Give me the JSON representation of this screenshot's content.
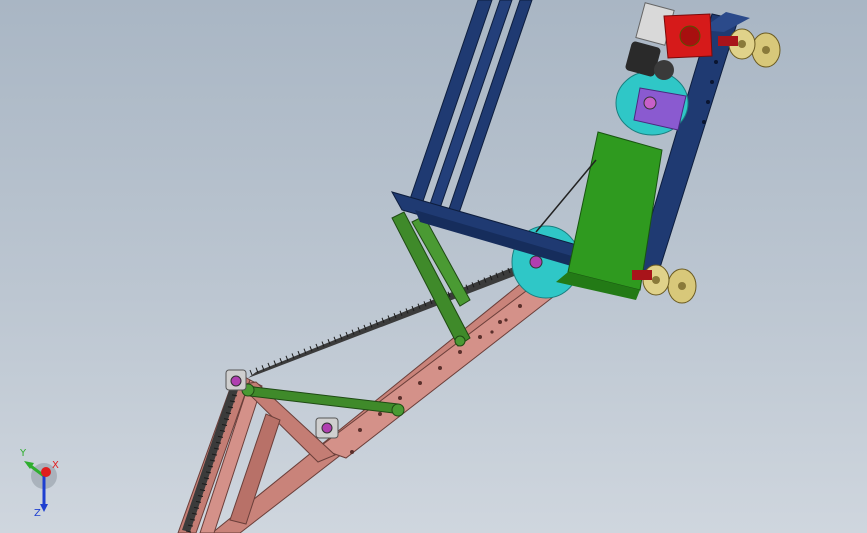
{
  "viewport": {
    "background_top": "#a9b6c4",
    "background_bottom": "#cfd6de"
  },
  "model": {
    "frame_color": "#1f3a72",
    "truss_color": "#c9837a",
    "link_color": "#3f8a2a",
    "rack_color": "#3b3b3b",
    "pulley_color": "#2fc7c7",
    "motor_color": "#d61a1a",
    "battery_color": "#2f9a1f",
    "wheel_color": "#d8c87a",
    "bracket_color": "#8a5ad0"
  },
  "triad": {
    "x_label": "X",
    "y_label": "Y",
    "z_label": "Z",
    "x_color": "#e01e1e",
    "y_color": "#2fae2f",
    "z_color": "#1e3fd0"
  }
}
